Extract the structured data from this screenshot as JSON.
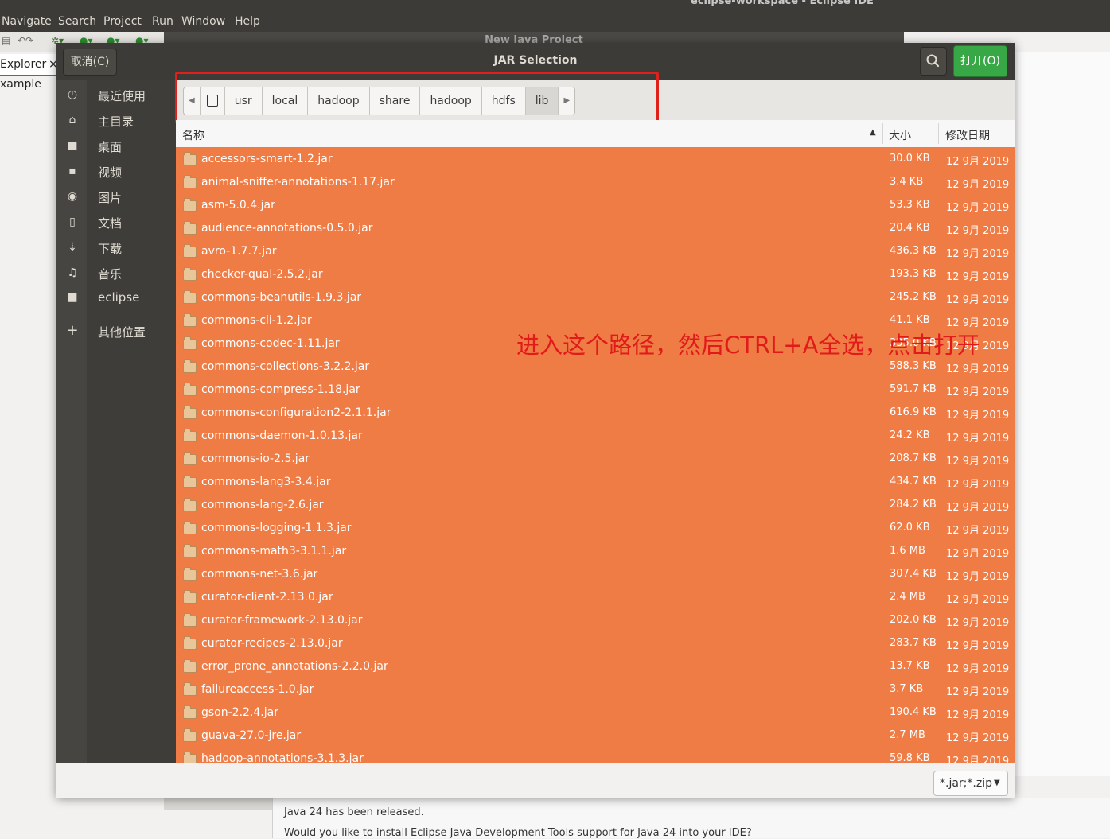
{
  "eclipse": {
    "window_title": "eclipse-workspace - Eclipse IDE",
    "menu": [
      "Navigate",
      "Search",
      "Project",
      "Run",
      "Window",
      "Help"
    ],
    "explorer_tab": "Explorer",
    "explorer_close": "×",
    "explorer_item": "xample",
    "behind_dialog_title": "New Java Project",
    "notification_line1": "Java 24 has been released.",
    "notification_line2": "Would you like to install Eclipse Java Development Tools support for Java 24 into your IDE?"
  },
  "dialog": {
    "title": "JAR Selection",
    "cancel_label": "取消(C)",
    "open_label": "打开(O)",
    "open_color": "#37a845",
    "search_icon": "search-icon"
  },
  "sidebar": {
    "items": [
      {
        "label": "最近使用",
        "icon": "clock-icon"
      },
      {
        "label": "主目录",
        "icon": "home-icon"
      },
      {
        "label": "桌面",
        "icon": "folder-icon"
      },
      {
        "label": "视频",
        "icon": "video-icon"
      },
      {
        "label": "图片",
        "icon": "camera-icon"
      },
      {
        "label": "文档",
        "icon": "document-icon"
      },
      {
        "label": "下载",
        "icon": "download-icon"
      },
      {
        "label": "音乐",
        "icon": "music-icon"
      },
      {
        "label": "eclipse",
        "icon": "folder-icon"
      },
      {
        "label": "其他位置",
        "icon": "plus-icon"
      }
    ]
  },
  "path": {
    "segments": [
      "usr",
      "local",
      "hadoop",
      "share",
      "hadoop",
      "hdfs",
      "lib"
    ],
    "active": "lib"
  },
  "table": {
    "headers": {
      "name": "名称",
      "size": "大小",
      "modified": "修改日期"
    },
    "selection_color": "#ef7b45",
    "rows": [
      {
        "name": "accessors-smart-1.2.jar",
        "size": "30.0 KB",
        "date": "12 9月 2019"
      },
      {
        "name": "animal-sniffer-annotations-1.17.jar",
        "size": "3.4 KB",
        "date": "12 9月 2019"
      },
      {
        "name": "asm-5.0.4.jar",
        "size": "53.3 KB",
        "date": "12 9月 2019"
      },
      {
        "name": "audience-annotations-0.5.0.jar",
        "size": "20.4 KB",
        "date": "12 9月 2019"
      },
      {
        "name": "avro-1.7.7.jar",
        "size": "436.3 KB",
        "date": "12 9月 2019"
      },
      {
        "name": "checker-qual-2.5.2.jar",
        "size": "193.3 KB",
        "date": "12 9月 2019"
      },
      {
        "name": "commons-beanutils-1.9.3.jar",
        "size": "245.2 KB",
        "date": "12 9月 2019"
      },
      {
        "name": "commons-cli-1.2.jar",
        "size": "41.1 KB",
        "date": "12 9月 2019"
      },
      {
        "name": "commons-codec-1.11.jar",
        "size": "335.0 KB",
        "date": "12 9月 2019"
      },
      {
        "name": "commons-collections-3.2.2.jar",
        "size": "588.3 KB",
        "date": "12 9月 2019"
      },
      {
        "name": "commons-compress-1.18.jar",
        "size": "591.7 KB",
        "date": "12 9月 2019"
      },
      {
        "name": "commons-configuration2-2.1.1.jar",
        "size": "616.9 KB",
        "date": "12 9月 2019"
      },
      {
        "name": "commons-daemon-1.0.13.jar",
        "size": "24.2 KB",
        "date": "12 9月 2019"
      },
      {
        "name": "commons-io-2.5.jar",
        "size": "208.7 KB",
        "date": "12 9月 2019"
      },
      {
        "name": "commons-lang3-3.4.jar",
        "size": "434.7 KB",
        "date": "12 9月 2019"
      },
      {
        "name": "commons-lang-2.6.jar",
        "size": "284.2 KB",
        "date": "12 9月 2019"
      },
      {
        "name": "commons-logging-1.1.3.jar",
        "size": "62.0 KB",
        "date": "12 9月 2019"
      },
      {
        "name": "commons-math3-3.1.1.jar",
        "size": "1.6 MB",
        "date": "12 9月 2019"
      },
      {
        "name": "commons-net-3.6.jar",
        "size": "307.4 KB",
        "date": "12 9月 2019"
      },
      {
        "name": "curator-client-2.13.0.jar",
        "size": "2.4 MB",
        "date": "12 9月 2019"
      },
      {
        "name": "curator-framework-2.13.0.jar",
        "size": "202.0 KB",
        "date": "12 9月 2019"
      },
      {
        "name": "curator-recipes-2.13.0.jar",
        "size": "283.7 KB",
        "date": "12 9月 2019"
      },
      {
        "name": "error_prone_annotations-2.2.0.jar",
        "size": "13.7 KB",
        "date": "12 9月 2019"
      },
      {
        "name": "failureaccess-1.0.jar",
        "size": "3.7 KB",
        "date": "12 9月 2019"
      },
      {
        "name": "gson-2.2.4.jar",
        "size": "190.4 KB",
        "date": "12 9月 2019"
      },
      {
        "name": "guava-27.0-jre.jar",
        "size": "2.7 MB",
        "date": "12 9月 2019"
      },
      {
        "name": "hadoop-annotations-3.1.3.jar",
        "size": "59.8 KB",
        "date": "12 9月 2019"
      }
    ]
  },
  "annotation": {
    "text": "进入这个路径，然后CTRL+A全选，点击打开",
    "color": "#e11a1a"
  },
  "filter": {
    "value": "*.jar;*.zip"
  }
}
